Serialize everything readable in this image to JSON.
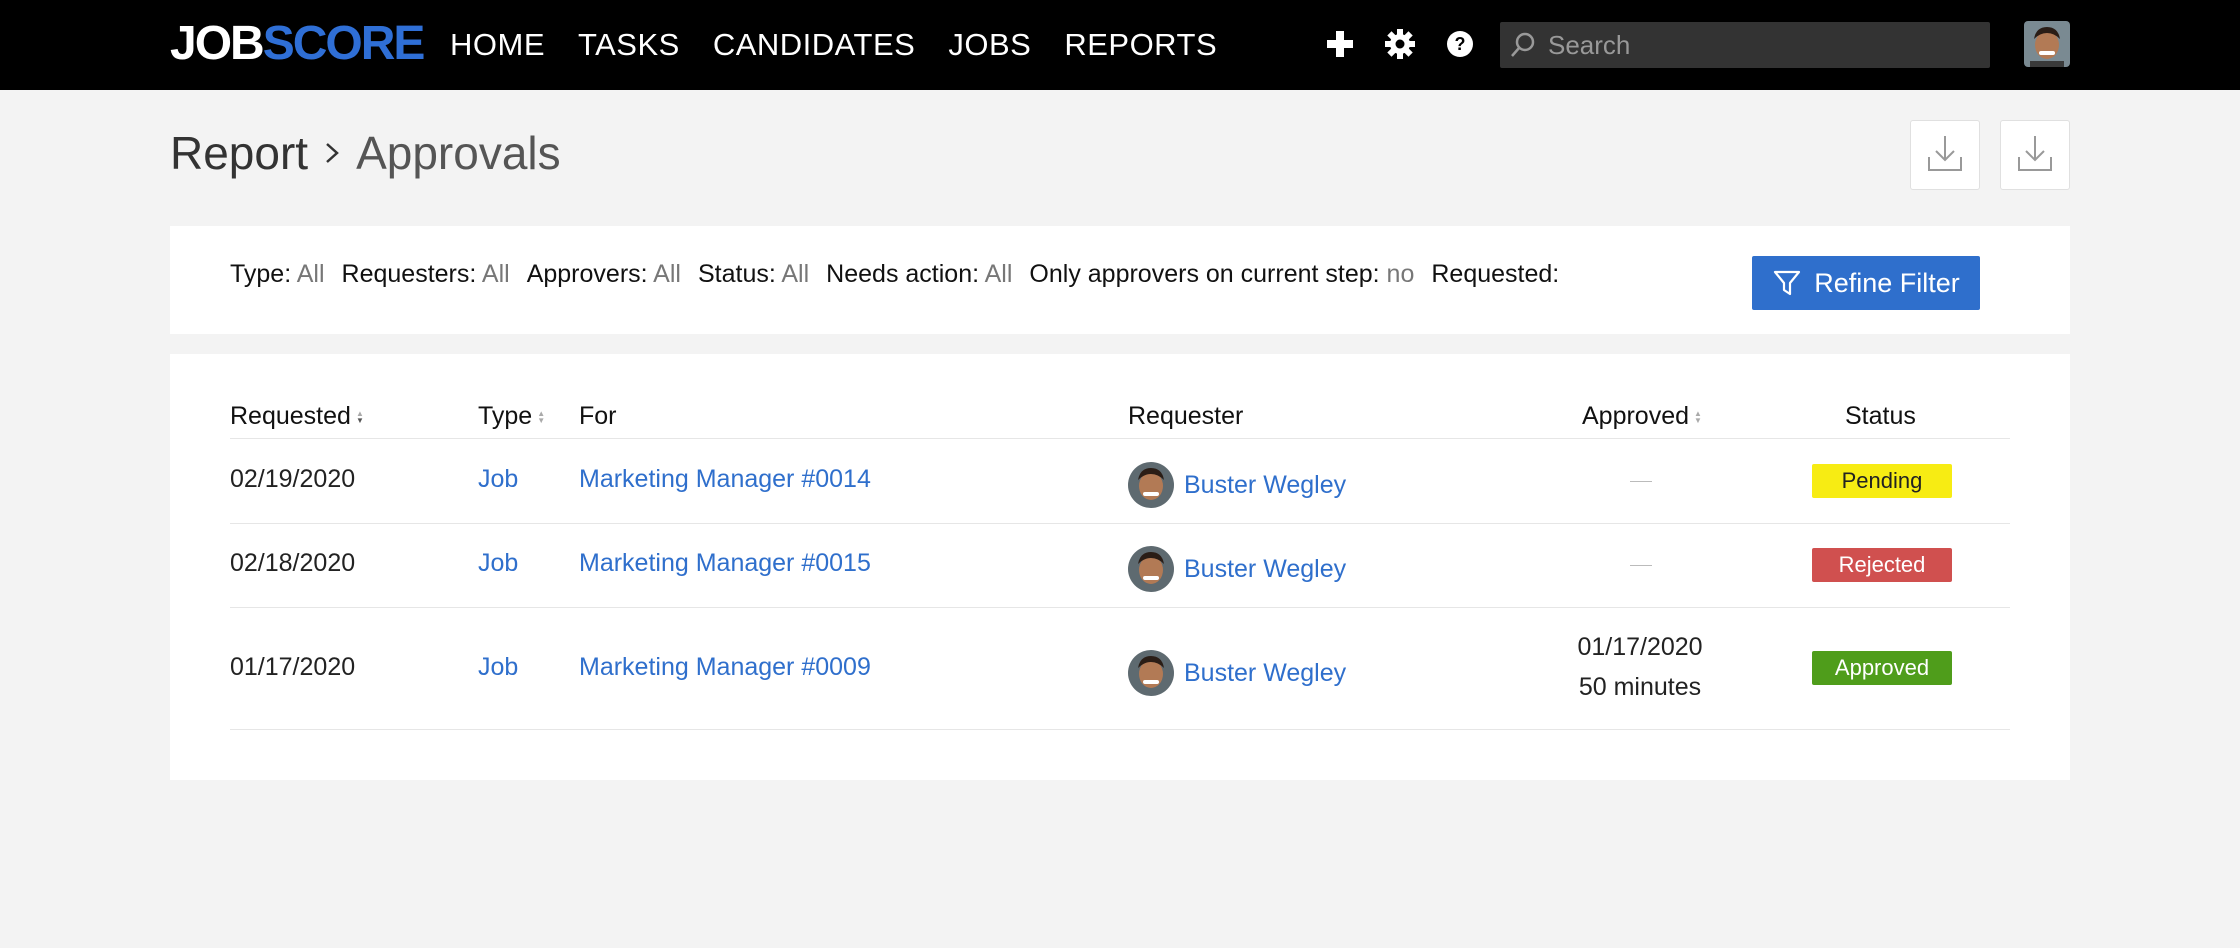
{
  "app": {
    "logo_part1": "JOB",
    "logo_part2": "SCORE"
  },
  "nav": {
    "items": [
      "HOME",
      "TASKS",
      "CANDIDATES",
      "JOBS",
      "REPORTS"
    ],
    "icons": [
      "plus-icon",
      "gear-icon",
      "help-icon"
    ],
    "search_placeholder": "Search"
  },
  "header": {
    "breadcrumb_root": "Report",
    "breadcrumb_current": "Approvals"
  },
  "filters": [
    {
      "label": "Type:",
      "value": "All"
    },
    {
      "label": "Requesters:",
      "value": "All"
    },
    {
      "label": "Approvers:",
      "value": "All"
    },
    {
      "label": "Status:",
      "value": "All"
    },
    {
      "label": "Needs action:",
      "value": "All"
    },
    {
      "label": "Only approvers on current step:",
      "value": "no"
    },
    {
      "label": "Requested:",
      "value": ""
    }
  ],
  "refine_label": "Refine Filter",
  "table": {
    "headers": {
      "requested": "Requested",
      "type": "Type",
      "for": "For",
      "requester": "Requester",
      "approved": "Approved",
      "status": "Status"
    },
    "rows": [
      {
        "requested": "02/19/2020",
        "type": "Job",
        "for": "Marketing Manager #0014",
        "requester": "Buster Wegley",
        "approved_date": "",
        "approved_duration": "",
        "status": "Pending"
      },
      {
        "requested": "02/18/2020",
        "type": "Job",
        "for": "Marketing Manager #0015",
        "requester": "Buster Wegley",
        "approved_date": "",
        "approved_duration": "",
        "status": "Rejected"
      },
      {
        "requested": "01/17/2020",
        "type": "Job",
        "for": "Marketing Manager #0009",
        "requester": "Buster Wegley",
        "approved_date": "01/17/2020",
        "approved_duration": "50 minutes",
        "status": "Approved"
      }
    ]
  },
  "colors": {
    "accent": "#2f6fcc",
    "pending": "#f7ec13",
    "rejected": "#d0504f",
    "approved": "#4f9d1b"
  }
}
